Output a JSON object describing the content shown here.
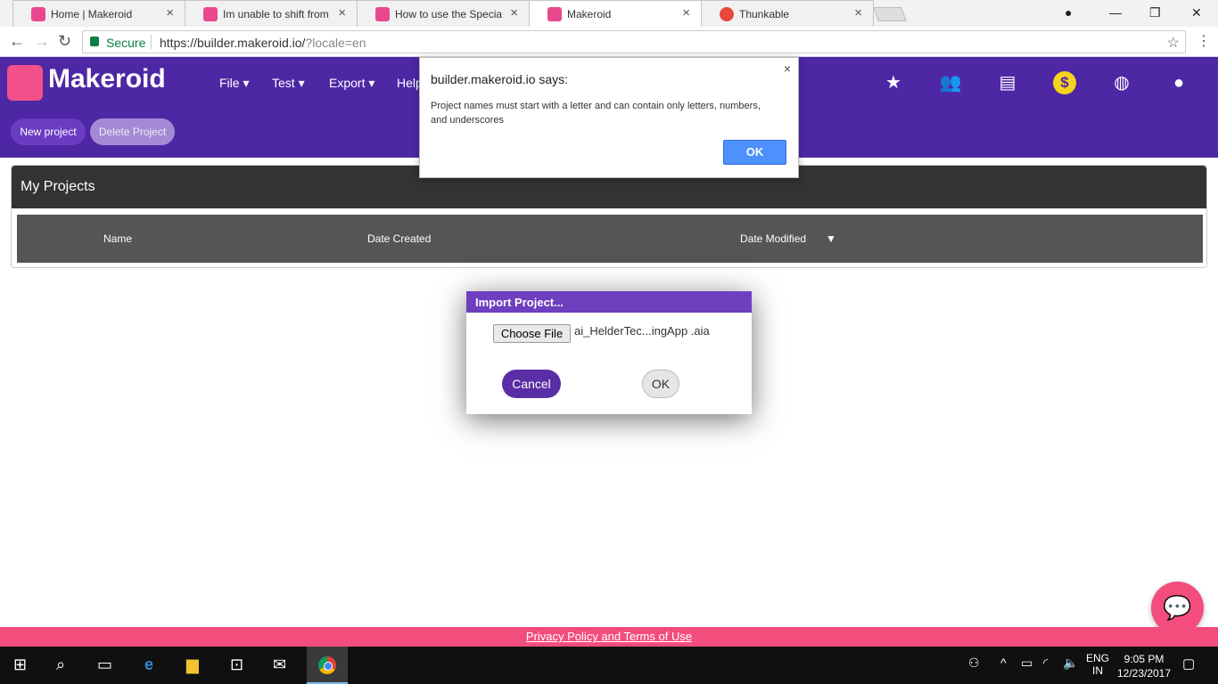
{
  "browser": {
    "tabs": [
      {
        "label": "Home | Makeroid",
        "icon": "makeroid-icon"
      },
      {
        "label": "Im unable to shift from m",
        "icon": "makeroid-icon"
      },
      {
        "label": "How to use the Special P",
        "icon": "makeroid-icon"
      },
      {
        "label": "Makeroid",
        "icon": "makeroid-icon",
        "active": true
      },
      {
        "label": "Thunkable",
        "icon": "thunkable-icon"
      }
    ],
    "close_glyph": "×",
    "secure_label": "Secure",
    "url_main": "https://builder.makeroid.io/",
    "url_query": "?locale=en"
  },
  "app": {
    "logo_text": "Makeroid",
    "menu": [
      "File ▾",
      "Test ▾",
      "Export ▾",
      "Help"
    ],
    "new_project": "New project",
    "delete_project": "Delete Project"
  },
  "projects": {
    "title": "My Projects",
    "columns": [
      "Name",
      "Date Created",
      "Date Modified"
    ],
    "sort_indicator": "▼"
  },
  "import_dialog": {
    "title": "Import Project...",
    "choose_file": "Choose File",
    "filename": "ai_HelderTec...ingApp .aia",
    "cancel": "Cancel",
    "ok": "OK"
  },
  "alert": {
    "title": "builder.makeroid.io says:",
    "message": "Project names must start with a letter and can contain only letters, numbers, and underscores",
    "ok": "OK",
    "close": "×"
  },
  "footer": {
    "link": "Privacy Policy and Terms of Use"
  },
  "taskbar": {
    "lang_top": "ENG",
    "lang_bottom": "IN",
    "time": "9:05 PM",
    "date": "12/23/2017"
  },
  "colors": {
    "brand_purple": "#4e27a5",
    "accent_pink": "#f34d7e",
    "dialog_blue": "#4d90fe"
  }
}
